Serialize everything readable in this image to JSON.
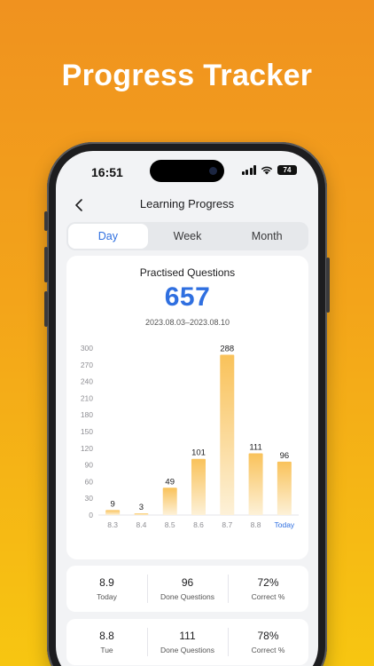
{
  "headline": "Progress Tracker",
  "status_bar": {
    "time": "16:51",
    "battery": "74"
  },
  "nav": {
    "title": "Learning Progress"
  },
  "tabs": [
    {
      "label": "Day",
      "active": true
    },
    {
      "label": "Week",
      "active": false
    },
    {
      "label": "Month",
      "active": false
    }
  ],
  "summary": {
    "title": "Practised Questions",
    "total": "657",
    "date_range": "2023.08.03–2023.08.10"
  },
  "chart_data": {
    "type": "bar",
    "categories": [
      "8.3",
      "8.4",
      "8.5",
      "8.6",
      "8.7",
      "8.8",
      "Today"
    ],
    "values": [
      9,
      3,
      49,
      101,
      288,
      111,
      96
    ],
    "title": "",
    "xlabel": "",
    "ylabel": "",
    "ylim": [
      0,
      300
    ],
    "yticks": [
      0,
      30,
      60,
      90,
      120,
      150,
      180,
      210,
      240,
      270,
      300
    ],
    "grid": false,
    "highlight_category": "Today",
    "colors": {
      "bar_top": "#f9c25a",
      "bar_bottom": "#fdf1d8",
      "highlight_label": "#2f6fe0",
      "axis_text": "#8e8e93"
    }
  },
  "stats": [
    {
      "date": "8.9",
      "date_label": "Today",
      "done": "96",
      "done_label": "Done Questions",
      "correct": "72%",
      "correct_label": "Correct %"
    },
    {
      "date": "8.8",
      "date_label": "Tue",
      "done": "111",
      "done_label": "Done Questions",
      "correct": "78%",
      "correct_label": "Correct %"
    }
  ],
  "colors": {
    "accent": "#2f6fe0",
    "background_top": "#f0921f",
    "background_bottom": "#f7c611"
  },
  "icons": [
    "back-chevron-icon",
    "signal-icon",
    "wifi-icon",
    "battery-icon"
  ]
}
